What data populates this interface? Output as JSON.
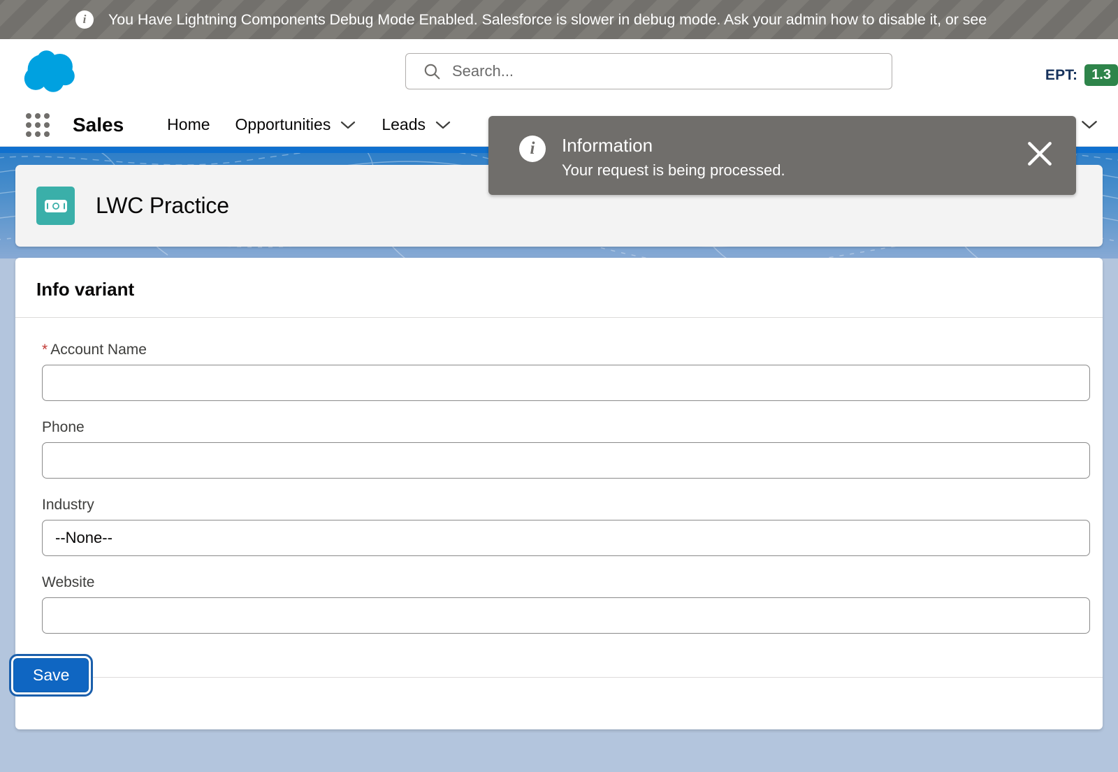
{
  "debug_banner": {
    "icon": "info-icon",
    "text": "You Have Lightning Components Debug Mode Enabled. Salesforce is slower in debug mode. Ask your admin how to disable it, or see"
  },
  "header": {
    "logo": "salesforce-cloud-logo",
    "search": {
      "icon": "search-icon",
      "placeholder": "Search...",
      "value": ""
    },
    "ept": {
      "label": "EPT:",
      "value": "1.3",
      "color": "#2e844a"
    }
  },
  "nav": {
    "app_launcher_icon": "app-launcher-waffle-icon",
    "app_name": "Sales",
    "items": [
      {
        "label": "Home",
        "has_chevron": false
      },
      {
        "label": "Opportunities",
        "has_chevron": true
      },
      {
        "label": "Leads",
        "has_chevron": true
      }
    ],
    "overflow_chevron": "chevron-down-icon"
  },
  "toast": {
    "icon": "info-icon",
    "title": "Information",
    "message": "Your request is being processed.",
    "close_icon": "close-icon",
    "background": "#706e6b"
  },
  "page": {
    "object_icon": "currency-banknote-icon",
    "object_icon_color": "#3aafa9",
    "title": "LWC Practice"
  },
  "form": {
    "section_title": "Info variant",
    "fields": [
      {
        "label": "Account Name",
        "required": true,
        "type": "text",
        "value": "",
        "name": "account-name"
      },
      {
        "label": "Phone",
        "required": false,
        "type": "text",
        "value": "",
        "name": "phone"
      },
      {
        "label": "Industry",
        "required": false,
        "type": "select",
        "value": "--None--",
        "name": "industry"
      },
      {
        "label": "Website",
        "required": false,
        "type": "text",
        "value": "",
        "name": "website"
      }
    ],
    "save_label": "Save",
    "save_color": "#0f66c2"
  }
}
